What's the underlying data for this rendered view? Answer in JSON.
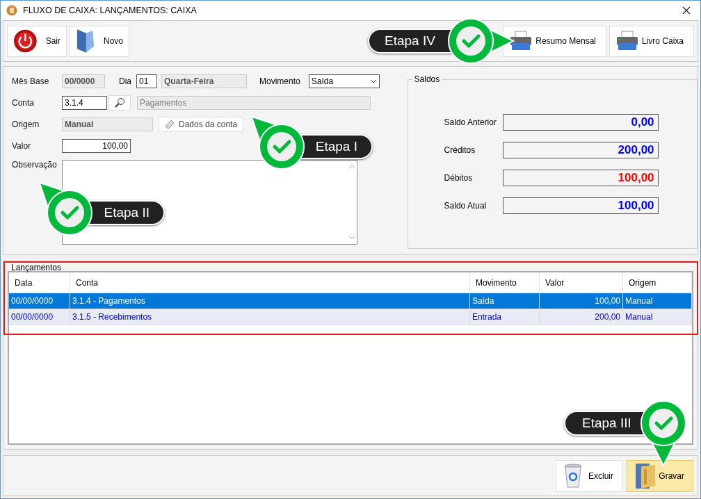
{
  "window": {
    "title": "FLUXO DE CAIXA: LANÇAMENTOS: CAIXA"
  },
  "toolbar": {
    "left": [
      {
        "label": "Sair"
      },
      {
        "label": "Novo"
      }
    ],
    "right": [
      {
        "label": "Resumo Mensal"
      },
      {
        "label": "Livro Caixa"
      }
    ]
  },
  "form": {
    "mes_base": {
      "label": "Mês Base",
      "value": "00/0000"
    },
    "dia": {
      "label": "Dia",
      "value": "01",
      "weekday": "Quarta-Feira"
    },
    "movimento": {
      "label": "Movimento",
      "value": "Saída"
    },
    "conta": {
      "label": "Conta",
      "value": "3.1.4",
      "description": "Pagamentos"
    },
    "origem": {
      "label": "Origem",
      "value": "Manual",
      "button": "Dados da conta"
    },
    "valor": {
      "label": "Valor",
      "value": "100,00"
    },
    "observacao": {
      "label": "Observação"
    }
  },
  "saldos": {
    "title": "Saldos",
    "rows": [
      {
        "label": "Saldo Anterior",
        "value": "0,00",
        "color": "#0000ff"
      },
      {
        "label": "Créditos",
        "value": "200,00",
        "color": "#0000ff"
      },
      {
        "label": "Débitos",
        "value": "100,00",
        "color": "#ff0000"
      },
      {
        "label": "Saldo Atual",
        "value": "100,00",
        "color": "#0000ff"
      }
    ]
  },
  "lancamentos": {
    "title": "Lançamentos",
    "columns": [
      "Data",
      "Conta",
      "Movimento",
      "Valor",
      "Origem"
    ],
    "rows": [
      {
        "cells": [
          "00/00/0000",
          "3.1.4 - Pagamentos",
          "Saída",
          "100,00",
          "Manual"
        ],
        "selected": true
      },
      {
        "cells": [
          "00/00/0000",
          "3.1.5 - Recebimentos",
          "Entrada",
          "200,00",
          "Manual"
        ],
        "selected": false
      }
    ]
  },
  "bottom_buttons": [
    {
      "label": "Excluir",
      "highlighted": false
    },
    {
      "label": "Gravar",
      "highlighted": true
    }
  ],
  "callouts": [
    {
      "label": "Etapa IV"
    },
    {
      "label": "Etapa I"
    },
    {
      "label": "Etapa II"
    },
    {
      "label": "Etapa III"
    }
  ]
}
